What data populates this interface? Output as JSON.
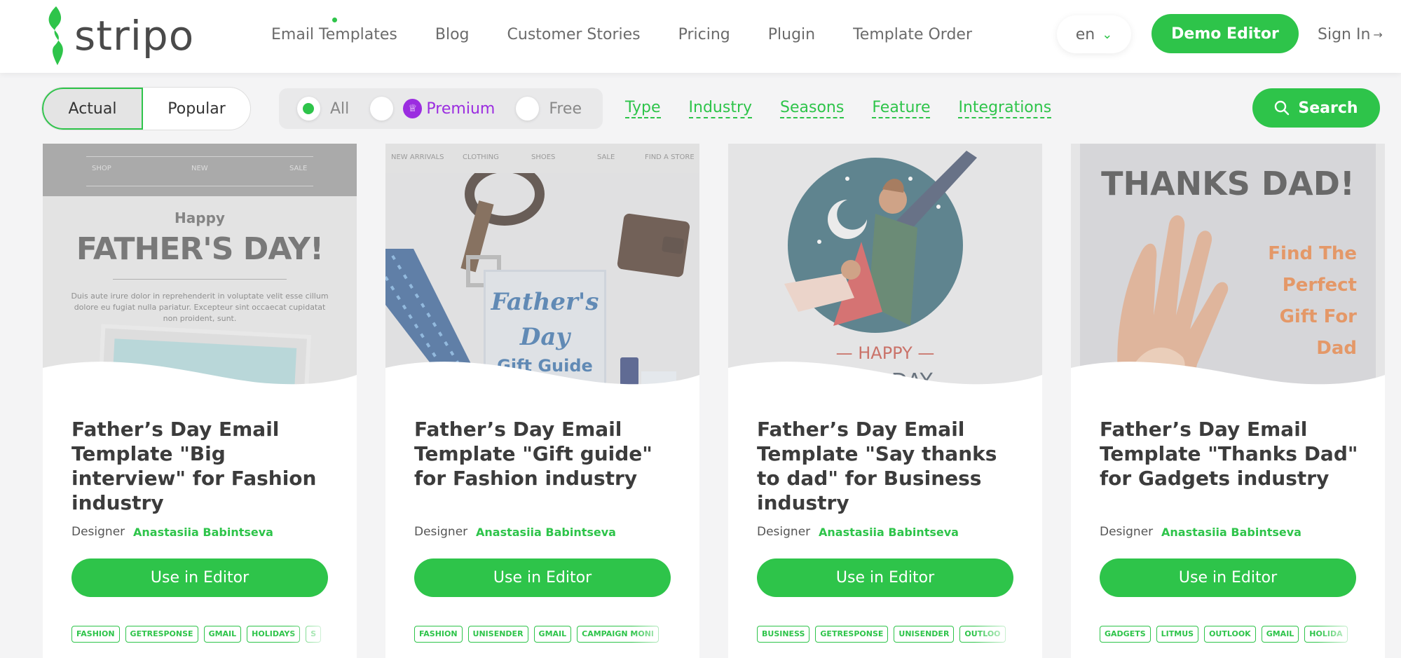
{
  "header": {
    "logo_text": "stripo",
    "nav": [
      "Email Templates",
      "Blog",
      "Customer Stories",
      "Pricing",
      "Plugin",
      "Template Order"
    ],
    "lang": "en",
    "demo_button": "Demo Editor",
    "sign_in": "Sign In"
  },
  "filters": {
    "sort": [
      "Actual",
      "Popular"
    ],
    "sort_active": "Actual",
    "pricing": [
      "All",
      "Premium",
      "Free"
    ],
    "pricing_selected": "All",
    "links": [
      "Type",
      "Industry",
      "Seasons",
      "Feature",
      "Integrations"
    ],
    "search_button": "Search"
  },
  "colors": {
    "brand_green": "#2ec44a",
    "premium_purple": "#9b2de0"
  },
  "cards": [
    {
      "title": "Father’s Day Email Template \"Big interview\" for Fashion industry",
      "designer_label": "Designer",
      "designer": "Anastasiia Babintseva",
      "button": "Use in Editor",
      "tags": [
        "FASHION",
        "GETRESPONSE",
        "GMAIL",
        "HOLIDAYS",
        "S"
      ],
      "thumb": {
        "nav": [
          "SHOP",
          "NEW",
          "SALE"
        ],
        "happy": "Happy",
        "headline": "FATHER'S DAY!",
        "body": "Duis aute irure dolor in reprehenderit in voluptate velit esse cillum dolore eu fugiat nulla pariatur. Excepteur sint occaecat cupidatat non proident, sunt."
      }
    },
    {
      "title": "Father’s Day Email Template \"Gift guide\" for Fashion industry",
      "designer_label": "Designer",
      "designer": "Anastasiia Babintseva",
      "button": "Use in Editor",
      "tags": [
        "FASHION",
        "UNISENDER",
        "GMAIL",
        "CAMPAIGN MONI"
      ],
      "thumb": {
        "nav": [
          "NEW ARRIVALS",
          "CLOTHING",
          "SHOES",
          "SALE",
          "FIND A STORE"
        ],
        "line1": "Father's",
        "line2": "Day",
        "line3": "Gift Guide"
      }
    },
    {
      "title": "Father’s Day Email Template \"Say thanks to dad\" for Business industry",
      "designer_label": "Designer",
      "designer": "Anastasiia Babintseva",
      "button": "Use in Editor",
      "tags": [
        "BUSINESS",
        "GETRESPONSE",
        "UNISENDER",
        "OUTLOO"
      ],
      "thumb": {
        "happy": "— HAPPY —",
        "headline": "ER'S DAY"
      }
    },
    {
      "title": "Father’s Day Email Template \"Thanks Dad\" for Gadgets industry",
      "designer_label": "Designer",
      "designer": "Anastasiia Babintseva",
      "button": "Use in Editor",
      "tags": [
        "GADGETS",
        "LITMUS",
        "OUTLOOK",
        "GMAIL",
        "HOLIDA"
      ],
      "thumb": {
        "headline": "THANKS DAD!",
        "sub": "Find The Perfect Gift For Dad"
      }
    }
  ]
}
